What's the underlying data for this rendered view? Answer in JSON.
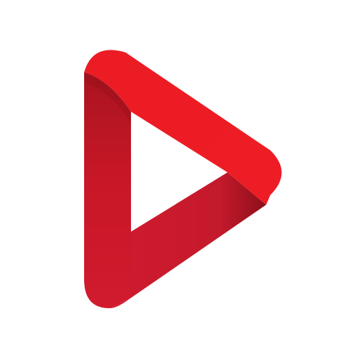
{
  "app_icon": {
    "name": "play-logo",
    "background": "#ffffff",
    "colors": {
      "bright_red": "#ec1c24",
      "mid_red": "#d11a2e",
      "dark_red": "#a9141f",
      "shadow_red": "#8e0f1a"
    },
    "icon": "play-triangle-icon"
  }
}
